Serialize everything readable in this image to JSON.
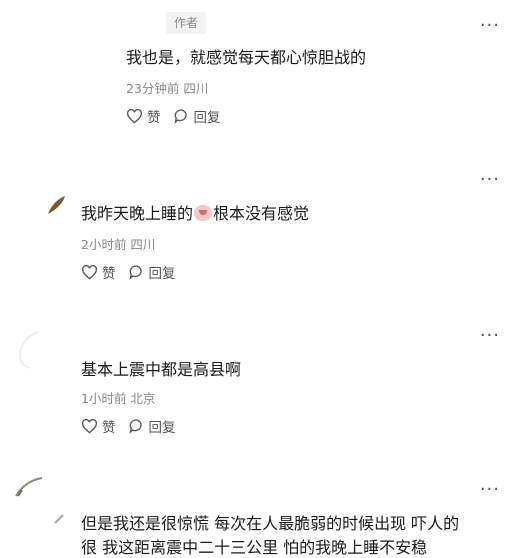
{
  "comments": [
    {
      "badge": "作者",
      "text": "我也是，就感觉每天都心惊胆战的",
      "meta": "23分钟前 四川",
      "like": "赞",
      "reply": "回复",
      "more": "···"
    },
    {
      "text_before": "我昨天晚上睡的",
      "text_after": "根本没有感觉",
      "meta": "2小时前 四川",
      "like": "赞",
      "reply": "回复",
      "more": "···"
    },
    {
      "text": "基本上震中都是高县啊",
      "meta": "1小时前 北京",
      "like": "赞",
      "reply": "回复",
      "more": "···"
    },
    {
      "line1": "但是我还是很惊慌 每次在人最脆弱的时候出现 吓人的",
      "line2": "很 我这距离震中二十三公里 怕的我晚上睡不安稳",
      "more": "···"
    }
  ]
}
